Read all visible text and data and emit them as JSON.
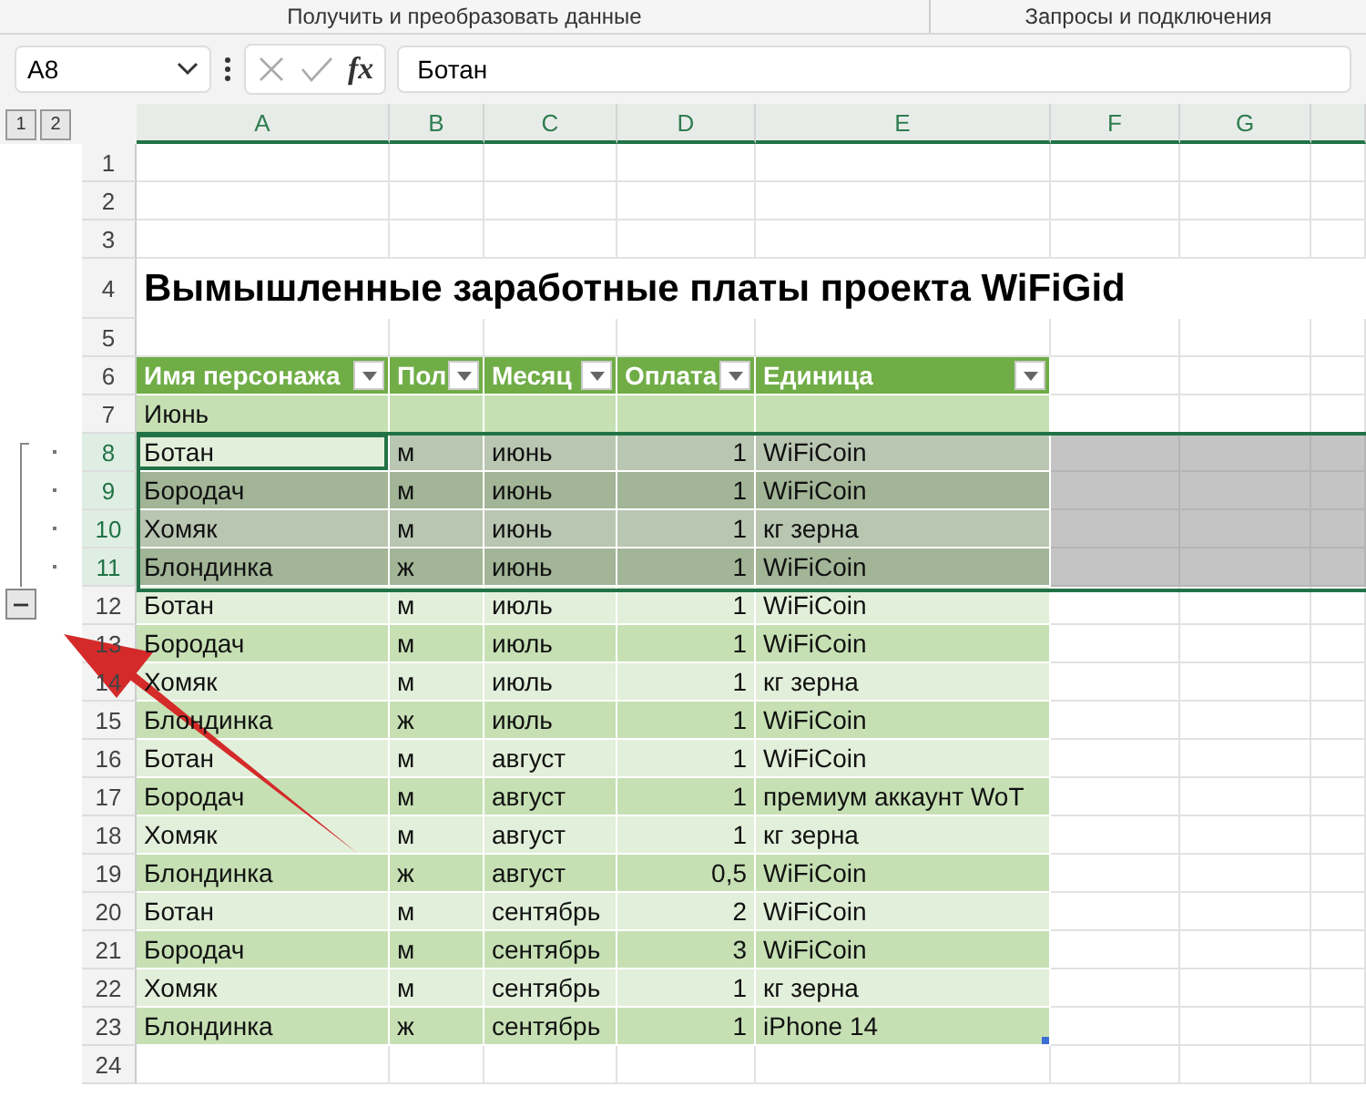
{
  "ribbon_groups": [
    "Получить и преобразовать данные",
    "Запросы и подключения"
  ],
  "formula_bar": {
    "name_box": "A8",
    "fx": "fx",
    "formula": "Ботан"
  },
  "outline_levels": [
    {
      "label": "1",
      "selected": false
    },
    {
      "label": "2",
      "selected": false
    }
  ],
  "columns": [
    "A",
    "B",
    "C",
    "D",
    "E",
    "F",
    "G"
  ],
  "rows": [
    {
      "number": "1",
      "kind": "blank"
    },
    {
      "number": "2",
      "kind": "blank"
    },
    {
      "number": "3",
      "kind": "blank"
    },
    {
      "number": "4",
      "kind": "title",
      "text": "Вымышленные заработные платы проекта WiFiGid"
    },
    {
      "number": "5",
      "kind": "blank"
    },
    {
      "number": "6",
      "kind": "header",
      "headers": [
        "Имя персонажа",
        "Пол",
        "Месяц",
        "Оплата",
        "Единица"
      ]
    },
    {
      "number": "7",
      "kind": "group",
      "text": "Июнь",
      "selected": false
    },
    {
      "number": "8",
      "kind": "data",
      "cells": [
        "Ботан",
        "м",
        "июнь",
        "1",
        "WiFiCoin"
      ],
      "selected": true,
      "active": true,
      "grouped": true
    },
    {
      "number": "9",
      "kind": "data",
      "cells": [
        "Бородач",
        "м",
        "июнь",
        "1",
        "WiFiCoin"
      ],
      "selected": true,
      "grouped": true
    },
    {
      "number": "10",
      "kind": "data",
      "cells": [
        "Хомяк",
        "м",
        "июнь",
        "1",
        "кг зерна"
      ],
      "selected": true,
      "grouped": true
    },
    {
      "number": "11",
      "kind": "data",
      "cells": [
        "Блондинка",
        "ж",
        "июнь",
        "1",
        "WiFiCoin"
      ],
      "selected": true,
      "grouped": true
    },
    {
      "number": "12",
      "kind": "data",
      "cells": [
        "Ботан",
        "м",
        "июль",
        "1",
        "WiFiCoin"
      ],
      "selected": false,
      "toggle": {
        "expanded": true
      }
    },
    {
      "number": "13",
      "kind": "data",
      "cells": [
        "Бородач",
        "м",
        "июль",
        "1",
        "WiFiCoin"
      ],
      "selected": false
    },
    {
      "number": "14",
      "kind": "data",
      "cells": [
        "Хомяк",
        "м",
        "июль",
        "1",
        "кг зерна"
      ],
      "selected": false
    },
    {
      "number": "15",
      "kind": "data",
      "cells": [
        "Блондинка",
        "ж",
        "июль",
        "1",
        "WiFiCoin"
      ],
      "selected": false
    },
    {
      "number": "16",
      "kind": "data",
      "cells": [
        "Ботан",
        "м",
        "август",
        "1",
        "WiFiCoin"
      ],
      "selected": false
    },
    {
      "number": "17",
      "kind": "data",
      "cells": [
        "Бородач",
        "м",
        "август",
        "1",
        "премиум аккаунт WoT"
      ],
      "selected": false
    },
    {
      "number": "18",
      "kind": "data",
      "cells": [
        "Хомяк",
        "м",
        "август",
        "1",
        "кг зерна"
      ],
      "selected": false
    },
    {
      "number": "19",
      "kind": "data",
      "cells": [
        "Блондинка",
        "ж",
        "август",
        "0,5",
        "WiFiCoin"
      ],
      "selected": false
    },
    {
      "number": "20",
      "kind": "data",
      "cells": [
        "Ботан",
        "м",
        "сентябрь",
        "2",
        "WiFiCoin"
      ],
      "selected": false
    },
    {
      "number": "21",
      "kind": "data",
      "cells": [
        "Бородач",
        "м",
        "сентябрь",
        "3",
        "WiFiCoin"
      ],
      "selected": false
    },
    {
      "number": "22",
      "kind": "data",
      "cells": [
        "Хомяк",
        "м",
        "сентябрь",
        "1",
        "кг зерна"
      ],
      "selected": false
    },
    {
      "number": "23",
      "kind": "data",
      "cells": [
        "Блондинка",
        "ж",
        "сентябрь",
        "1",
        "iPhone 14"
      ],
      "selected": false,
      "table_end": true
    },
    {
      "number": "24",
      "kind": "blank"
    }
  ]
}
